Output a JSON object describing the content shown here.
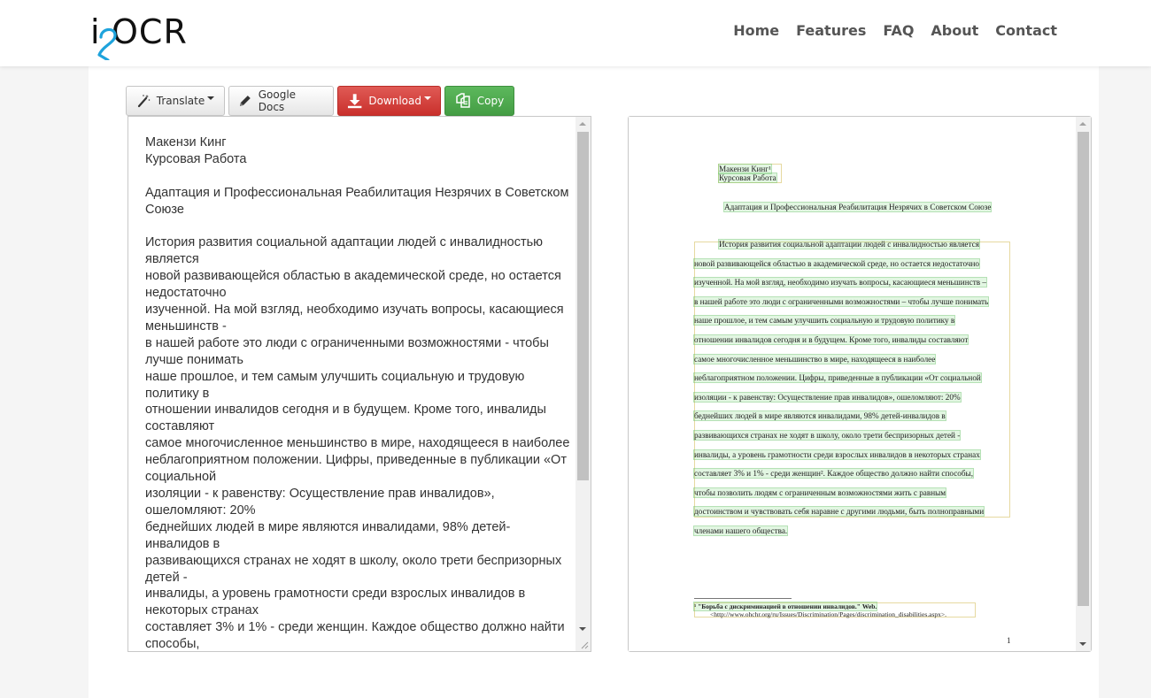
{
  "header": {
    "logo": {
      "prefix": "i",
      "middle": "2",
      "suffix": "OCR"
    },
    "nav": [
      {
        "label": "Home"
      },
      {
        "label": "Features"
      },
      {
        "label": "FAQ"
      },
      {
        "label": "About"
      },
      {
        "label": "Contact"
      }
    ]
  },
  "colors": {
    "logo_accent": "#1ea3dc",
    "danger": "#d9534f",
    "success": "#5cb85c",
    "highlight": "#8cdc8c"
  },
  "toolbar": {
    "translate": {
      "label": "Translate",
      "icon": "magic-wand-icon"
    },
    "google_docs": {
      "label": "Google Docs",
      "icon": "pencil-icon"
    },
    "download": {
      "label": "Download",
      "icon": "download-icon"
    },
    "copy": {
      "label": "Copy",
      "icon": "copy-icon"
    }
  },
  "ocr_text": {
    "lines": [
      "Макензи Кинг",
      "Курсовая Работа",
      "",
      "Адаптация и Профессиональная Реабилитация Незрячих в Советском",
      "Союзе",
      "",
      "История развития социальной адаптации людей с инвалидностью",
      "является",
      "новой развивающейся областью в академической среде, но остается",
      "недостаточно",
      "изученной. На мой взгляд, необходимо изучать вопросы, касающиеся",
      "меньшинств -",
      "в нашей работе это люди с ограниченными возможностями - чтобы",
      "лучше понимать",
      "наше прошлое, и тем самым улучшить социальную и трудовую",
      "политику в",
      "отношении инвалидов сегодня и в будущем. Кроме того, инвалиды",
      "составляют",
      "самое многочисленное меньшинство в мире, находящееся в наиболее",
      "неблагоприятном положении. Цифры, приведенные в публикации «От",
      "социальной",
      "изоляции - к равенству: Осуществление прав инвалидов»,",
      "ошеломляют: 20%",
      "беднейших людей в мире являются инвалидами, 98% детей-",
      "инвалидов в",
      "развивающихся странах не ходят в школу, около трети беспризорных",
      "детей -",
      "инвалиды, а уровень грамотности среди взрослых инвалидов в",
      "некоторых странах",
      "составляет 3% и 1% - среди женщин. Каждое общество должно найти",
      "способы,"
    ]
  },
  "preview": {
    "author": "Макензи Кинг¹",
    "subtitle": "Курсовая Работа",
    "title": "Адаптация и Профессиональная Реабилитация Незрячих в Советском Союзе",
    "body_lines": [
      "История развития социальной адаптации людей с инвалидностью является",
      "новой развивающейся областью в академической среде, но остается недостаточно",
      "изученной. На мой взгляд, необходимо изучать вопросы, касающиеся меньшинств –",
      "в нашей работе это люди с ограниченными возможностями – чтобы лучше понимать",
      "наше прошлое, и тем самым улучшить социальную и трудовую политику в",
      "отношении инвалидов сегодня и в будущем. Кроме того, инвалиды составляют",
      "самое многочисленное меньшинство в мире, находящееся в наиболее",
      "неблагоприятном положении. Цифры, приведенные в публикации «От социальной",
      "изоляции - к равенству: Осуществление прав инвалидов», ошеломляют: 20%",
      "беднейших людей в мире являются инвалидами, 98% детей-инвалидов в",
      "развивающихся странах не ходят в школу, около трети беспризорных детей -",
      "инвалиды, а уровень грамотности среди взрослых инвалидов в некоторых странах",
      "составляет 3% и 1% - среди женщин². Каждое общество должно найти способы,",
      "чтобы позволить людям с ограниченным возможностями жить с равным",
      "достоинством и чувствовать себя наравне с другими людьми, быть полноправными",
      "членами нашего общества."
    ],
    "footnote_line1": "¹ \"Борьба с дискриминацией в отношении инвалидов.\" Web.",
    "footnote_line2": "<http://www.ohchr.org/ru/Issues/Discrimination/Pages/discrimination_disabilities.aspx>.",
    "page_number": "1"
  }
}
